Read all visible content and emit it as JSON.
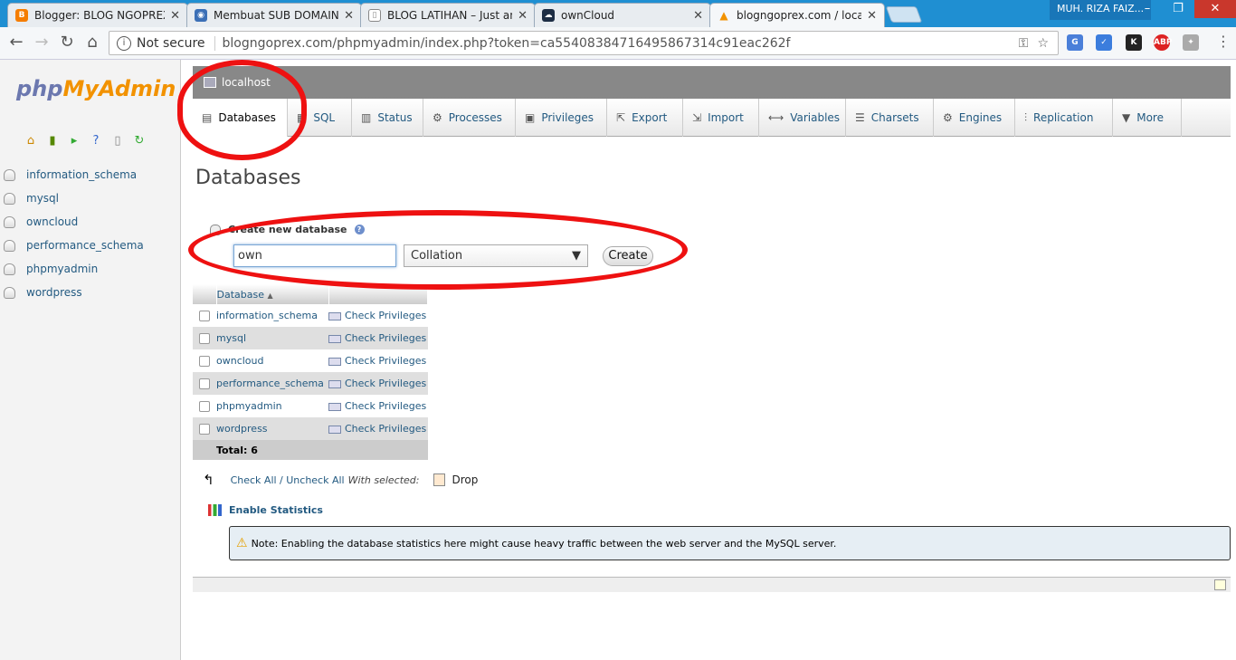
{
  "browser": {
    "tabs": [
      {
        "label": "Blogger: BLOG NGOPREX",
        "favicon_color": "#f57d00",
        "favicon": "B"
      },
      {
        "label": "Membuat SUB DOMAIN",
        "favicon_color": "#3b6fb6",
        "favicon": "◉"
      },
      {
        "label": "BLOG LATIHAN – Just an",
        "favicon_color": "#ffffff",
        "favicon": "▯"
      },
      {
        "label": "ownCloud",
        "favicon_color": "#1d2d44",
        "favicon": "☁"
      },
      {
        "label": "blogngoprex.com / local",
        "favicon_color": "#f29200",
        "favicon": "▲"
      }
    ],
    "active_tab": 4,
    "profile_name": "MUH. RIZA FAIZ...",
    "not_secure": "Not secure",
    "url": "blogngoprex.com/phpmyadmin/index.php?token=ca55408384716495867314c91eac262f"
  },
  "sidebar": {
    "logo_php": "php",
    "logo_my": "MyAdmin",
    "databases": [
      "information_schema",
      "mysql",
      "owncloud",
      "performance_schema",
      "phpmyadmin",
      "wordpress"
    ]
  },
  "server": {
    "name": "localhost"
  },
  "top_menu": [
    {
      "label": "Databases",
      "icon": "database-icon",
      "glyph": "▤"
    },
    {
      "label": "SQL",
      "icon": "sql-icon",
      "glyph": "▦"
    },
    {
      "label": "Status",
      "icon": "status-icon",
      "glyph": "▥"
    },
    {
      "label": "Processes",
      "icon": "processes-icon",
      "glyph": "⚙"
    },
    {
      "label": "Privileges",
      "icon": "privileges-icon",
      "glyph": "▣"
    },
    {
      "label": "Export",
      "icon": "export-icon",
      "glyph": "⇱"
    },
    {
      "label": "Import",
      "icon": "import-icon",
      "glyph": "⇲"
    },
    {
      "label": "Variables",
      "icon": "variables-icon",
      "glyph": "⟷"
    },
    {
      "label": "Charsets",
      "icon": "charsets-icon",
      "glyph": "☰"
    },
    {
      "label": "Engines",
      "icon": "engines-icon",
      "glyph": "⚙"
    },
    {
      "label": "Replication",
      "icon": "replication-icon",
      "glyph": "⫶"
    },
    {
      "label": "More",
      "icon": "more-icon",
      "glyph": "▼"
    }
  ],
  "main": {
    "title": "Databases",
    "create": {
      "label": "Create new database",
      "db_name_value": "own",
      "collation": "Collation",
      "button": "Create"
    },
    "table": {
      "header": "Database",
      "rows": [
        {
          "name": "information_schema",
          "action": "Check Privileges"
        },
        {
          "name": "mysql",
          "action": "Check Privileges"
        },
        {
          "name": "owncloud",
          "action": "Check Privileges"
        },
        {
          "name": "performance_schema",
          "action": "Check Privileges"
        },
        {
          "name": "phpmyadmin",
          "action": "Check Privileges"
        },
        {
          "name": "wordpress",
          "action": "Check Privileges"
        }
      ],
      "total": "Total: 6"
    },
    "check_all": "Check All / Uncheck All",
    "with_selected": "With selected:",
    "drop": "Drop",
    "enable_statistics": "Enable Statistics",
    "notice": "Note: Enabling the database statistics here might cause heavy traffic between the web server and the MySQL server."
  }
}
